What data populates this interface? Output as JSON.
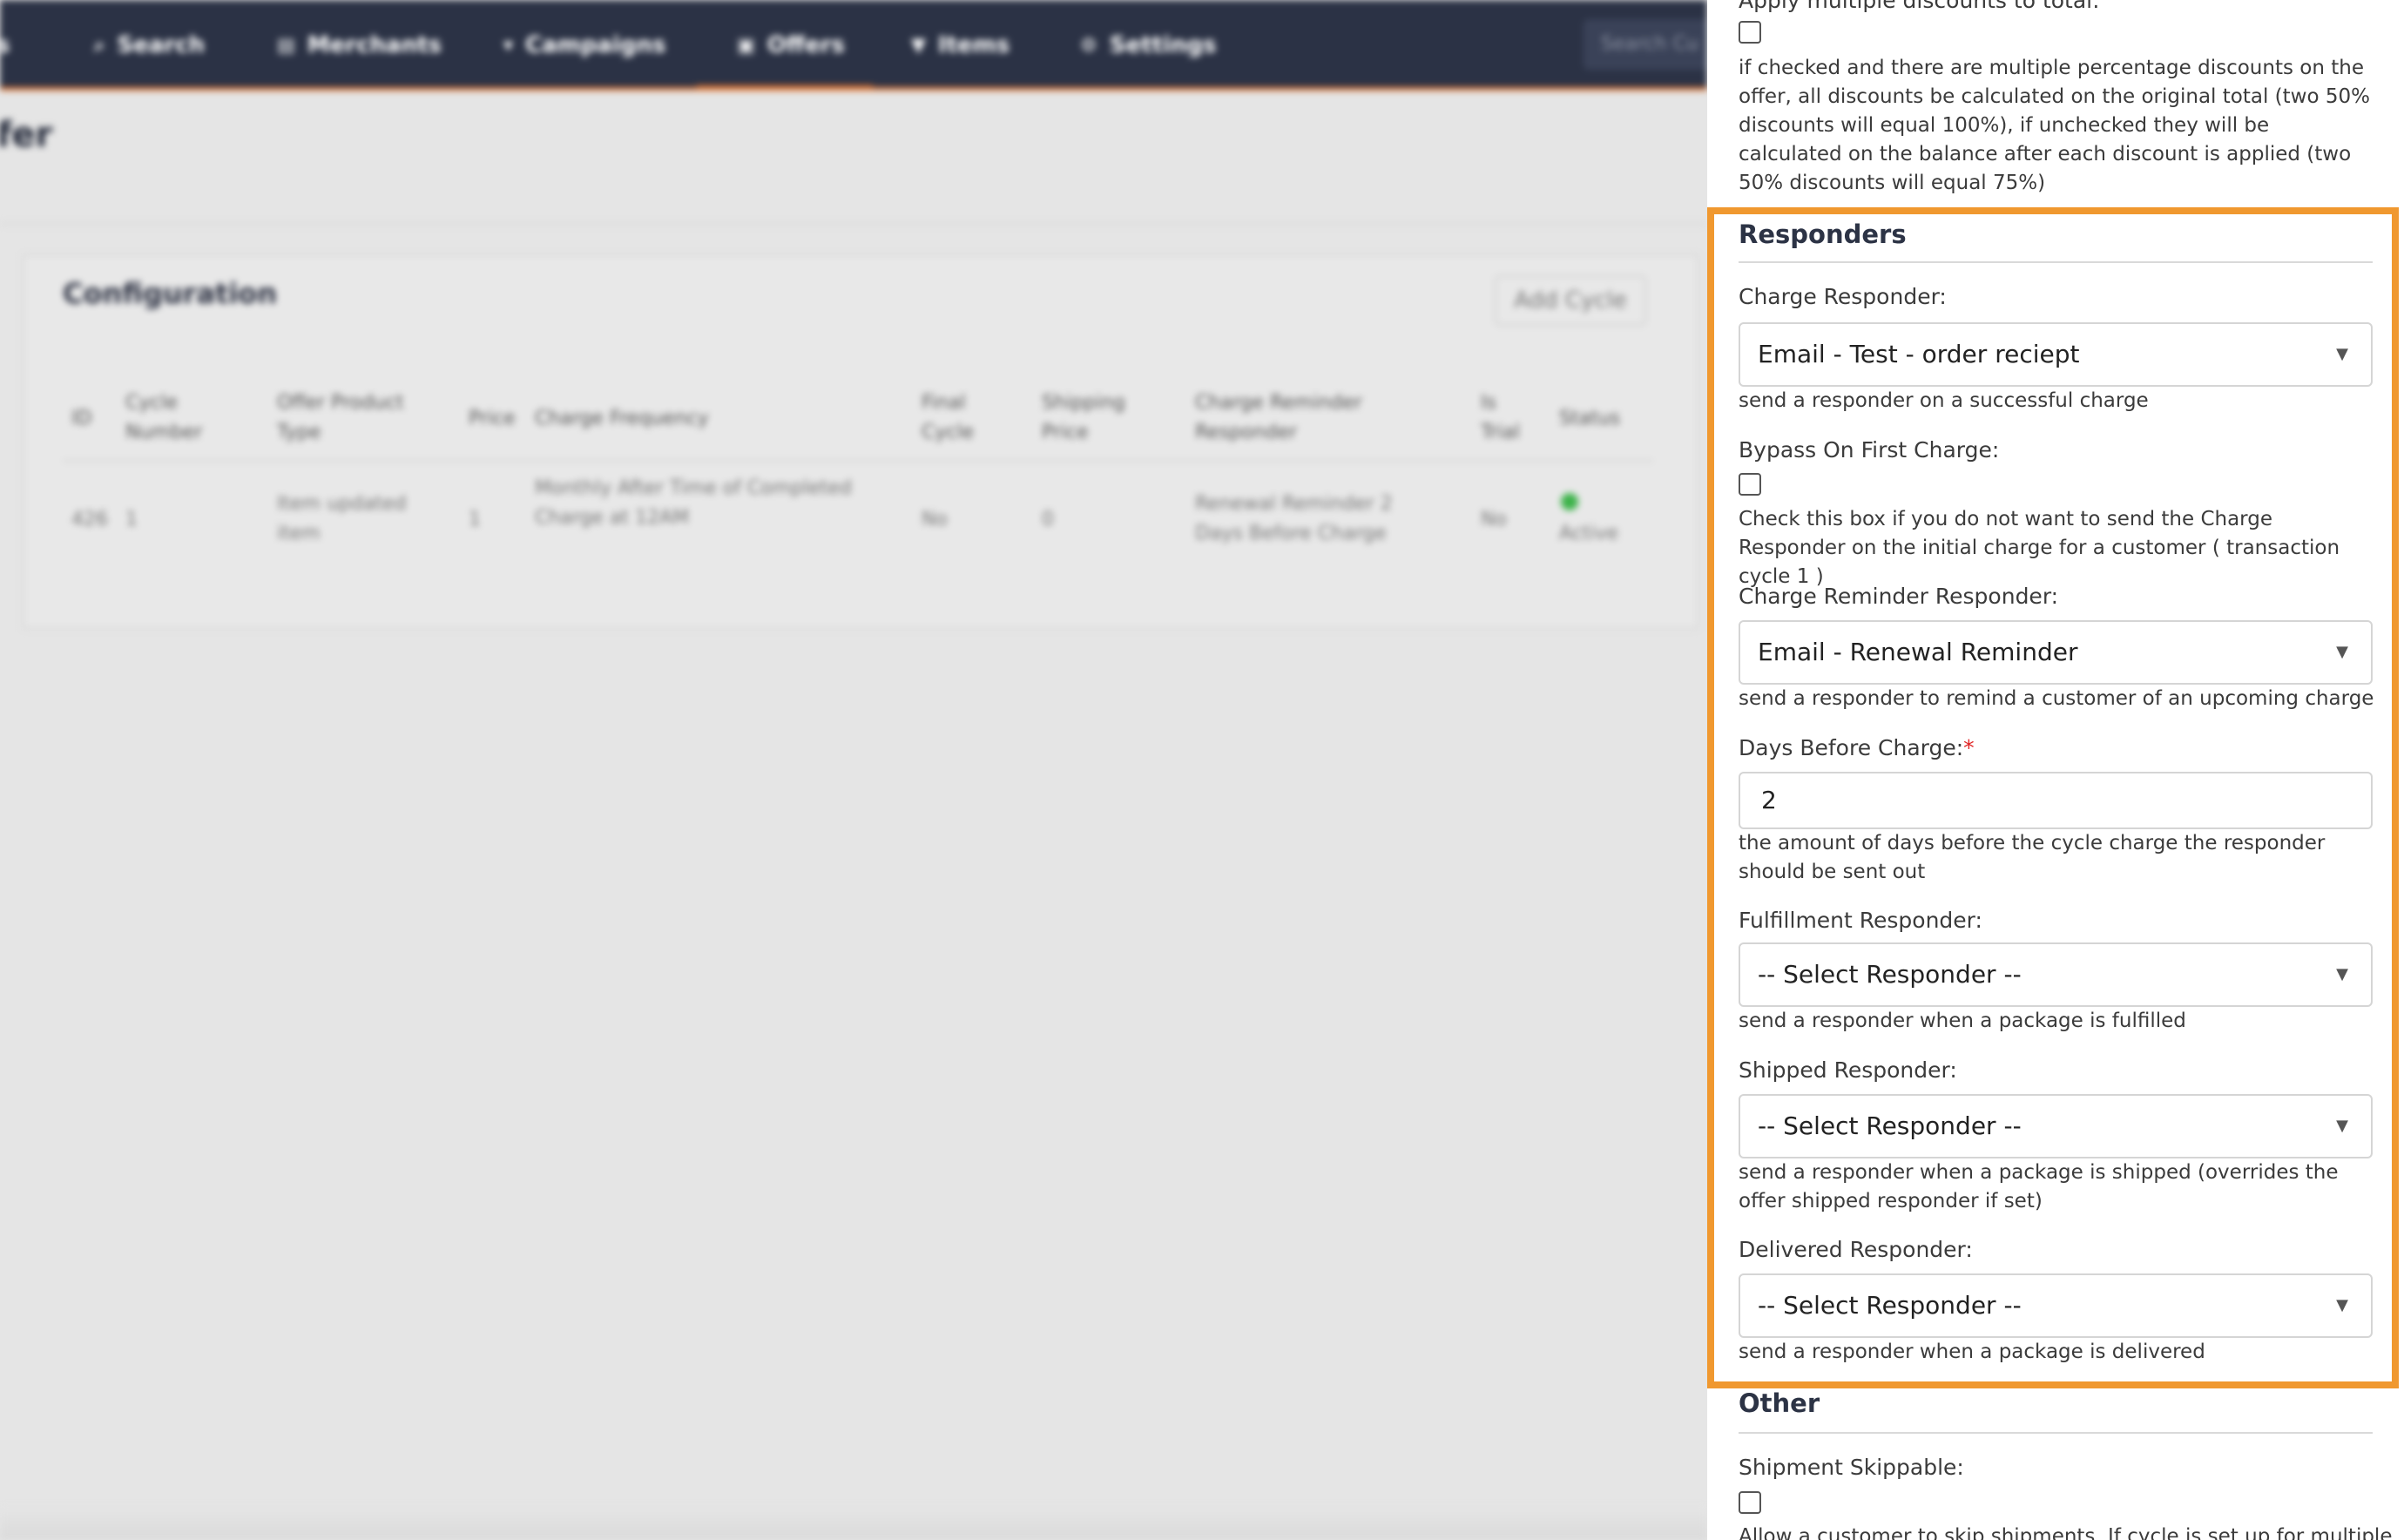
{
  "background": {
    "nav": {
      "items": [
        {
          "label": "Search",
          "icon": "search-icon",
          "glyph": "⌕"
        },
        {
          "label": "Merchants",
          "icon": "merchants-icon",
          "glyph": "▤"
        },
        {
          "label": "Campaigns",
          "icon": "campaigns-icon",
          "glyph": "▾"
        },
        {
          "label": "Offers",
          "icon": "offers-icon",
          "glyph": "▣"
        },
        {
          "label": "Items",
          "icon": "items-icon",
          "glyph": "▼"
        },
        {
          "label": "Settings",
          "icon": "settings-icon",
          "glyph": "⚙"
        }
      ],
      "search_placeholder": "Search Cu",
      "leading_fragment": "s"
    },
    "page_title": "fer",
    "card": {
      "title": "Configuration",
      "add_button": "Add Cycle",
      "columns": [
        "ID",
        "Cycle Number",
        "Offer Product Type",
        "Price",
        "Charge Frequency",
        "Final Cycle",
        "Shipping Price",
        "Charge Reminder Responder",
        "Is Trial",
        "Status"
      ],
      "row": {
        "id": "426",
        "cycle_number": "1",
        "product_type": "Item updated item",
        "price": "1",
        "charge_frequency": "Monthly After Time of Completed Charge at 12AM",
        "final_cycle": "No",
        "shipping_price": "0",
        "reminder": "Renewal Reminder 2 Days Before Charge",
        "is_trial": "No",
        "status": "Active"
      }
    }
  },
  "panel": {
    "apply_multiple": {
      "label": "Apply multiple discounts to total:",
      "help": "if checked and there are multiple percentage discounts on the offer, all discounts be calculated on the original total (two 50% discounts will equal 100%), if unchecked they will be calculated on the balance after each discount is applied (two 50% discounts will equal 75%)"
    },
    "responders": {
      "title": "Responders",
      "charge": {
        "label": "Charge Responder:",
        "value": "Email - Test - order reciept",
        "help": "send a responder on a successful charge"
      },
      "bypass": {
        "label": "Bypass On First Charge:",
        "help": "Check this box if you do not want to send the Charge Responder on the initial charge for a customer ( transaction cycle 1 )"
      },
      "reminder": {
        "label": "Charge Reminder Responder:",
        "value": "Email - Renewal Reminder",
        "help": "send a responder to remind a customer of an upcoming charge"
      },
      "days": {
        "label": "Days Before Charge:",
        "required_mark": "*",
        "value": "2",
        "help": "the amount of days before the cycle charge the responder should be sent out"
      },
      "fulfillment": {
        "label": "Fulfillment Responder:",
        "value": "-- Select Responder --",
        "help": "send a responder when a package is fulfilled"
      },
      "shipped": {
        "label": "Shipped Responder:",
        "value": "-- Select Responder --",
        "help": "send a responder when a package is shipped (overrides the offer shipped responder if set)"
      },
      "delivered": {
        "label": "Delivered Responder:",
        "value": "-- Select Responder --",
        "help": "send a responder when a package is delivered"
      }
    },
    "other": {
      "title": "Other",
      "skippable": {
        "label": "Shipment Skippable:",
        "help": "Allow a customer to skip shipments. If cycle is set up for multiple"
      }
    },
    "caret": "▼"
  },
  "colors": {
    "nav_bg": "#2b3245",
    "accent": "#e0722c",
    "highlight": "#f0982f"
  }
}
